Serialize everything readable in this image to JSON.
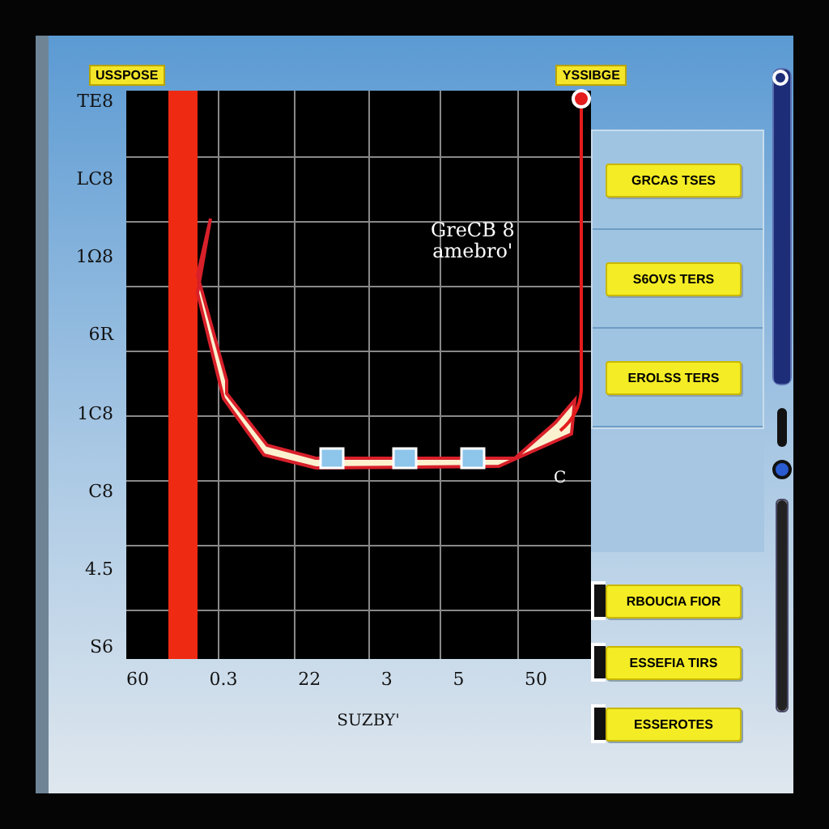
{
  "header": {
    "left_label": "USSPOSE",
    "right_label": "YSSIBGE"
  },
  "plot": {
    "y_ticks": [
      "TE8",
      "LC8",
      "1Ω8",
      "6R",
      "1C8",
      "C8",
      "4.5",
      "S6"
    ],
    "x_ticks": [
      "60",
      "0.3",
      "22",
      "3",
      "5",
      "50"
    ],
    "x_title": "SUZBY'",
    "annotation": [
      "GreCB 8",
      "amebro'"
    ],
    "side_mark": "C"
  },
  "tag_panel": {
    "upper_tags": [
      "GRCAS TSES",
      "S6OVS TERS",
      "EROLSS TERS"
    ],
    "lower_tags": [
      "RBOUCIA FIOR",
      "ESSEFIA TIRS",
      "ESSEROTES"
    ]
  },
  "sliders": [
    {
      "level": 1
    },
    {
      "level": 1
    }
  ]
}
